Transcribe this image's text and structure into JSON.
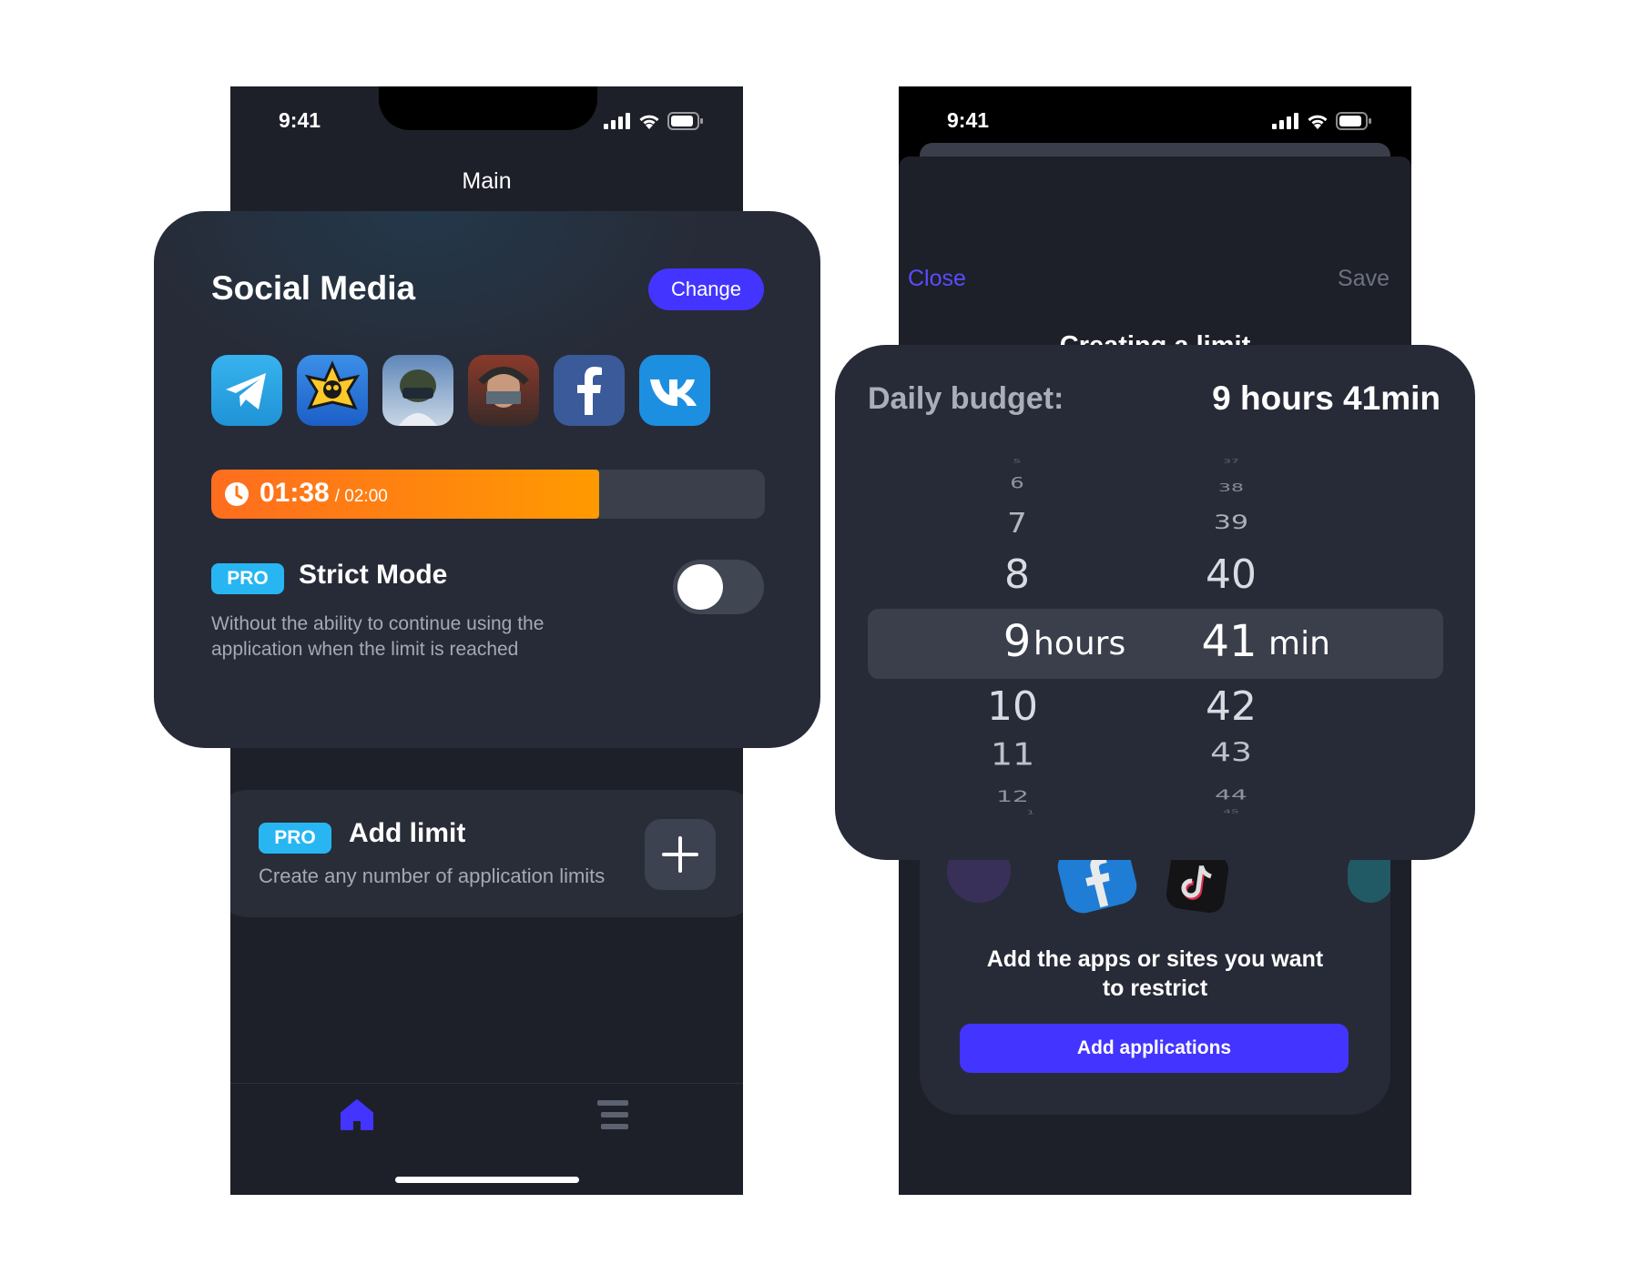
{
  "left": {
    "status": {
      "time": "9:41"
    },
    "nav_title": "Main",
    "group": {
      "title": "Social Media",
      "change_label": "Change",
      "apps": [
        "telegram-icon",
        "brawl-stars-icon",
        "pubg-icon",
        "standoff-icon",
        "facebook-icon",
        "vk-icon"
      ],
      "timer": {
        "used": "01:38",
        "limit": "/ 02:00",
        "progress": 0.7
      }
    },
    "strict_mode": {
      "badge": "PRO",
      "title": "Strict Mode",
      "description_line1": "Without the ability to continue using the",
      "description_line2": "application when the limit is reached",
      "enabled": false
    },
    "add_limit": {
      "badge": "PRO",
      "title": "Add limit",
      "subtitle": "Create any number of application limits"
    },
    "tabs": [
      "home-icon",
      "list-icon"
    ]
  },
  "right": {
    "status": {
      "time": "9:41"
    },
    "close_label": "Close",
    "save_label": "Save",
    "title": "Creating a limit",
    "budget": {
      "label": "Daily budget:",
      "value": "9 hours 41min",
      "hours_above": [
        "5",
        "6",
        "7",
        "8"
      ],
      "hours_selected": "9",
      "hours_unit": "hours",
      "hours_below": [
        "10",
        "11",
        "12",
        "1"
      ],
      "minutes_above": [
        "37",
        "38",
        "39",
        "40"
      ],
      "minutes_selected": "41",
      "minutes_unit": "min",
      "minutes_below": [
        "42",
        "43",
        "44",
        "45"
      ]
    },
    "apps_prompt_line1": "Add the apps or sites you want",
    "apps_prompt_line2": "to restrict",
    "add_apps_label": "Add applications"
  },
  "colors": {
    "accent": "#4335ff",
    "pro": "#27b6f2",
    "progress": "#ff8a00",
    "card": "#272b37",
    "background": "#1d2029"
  }
}
